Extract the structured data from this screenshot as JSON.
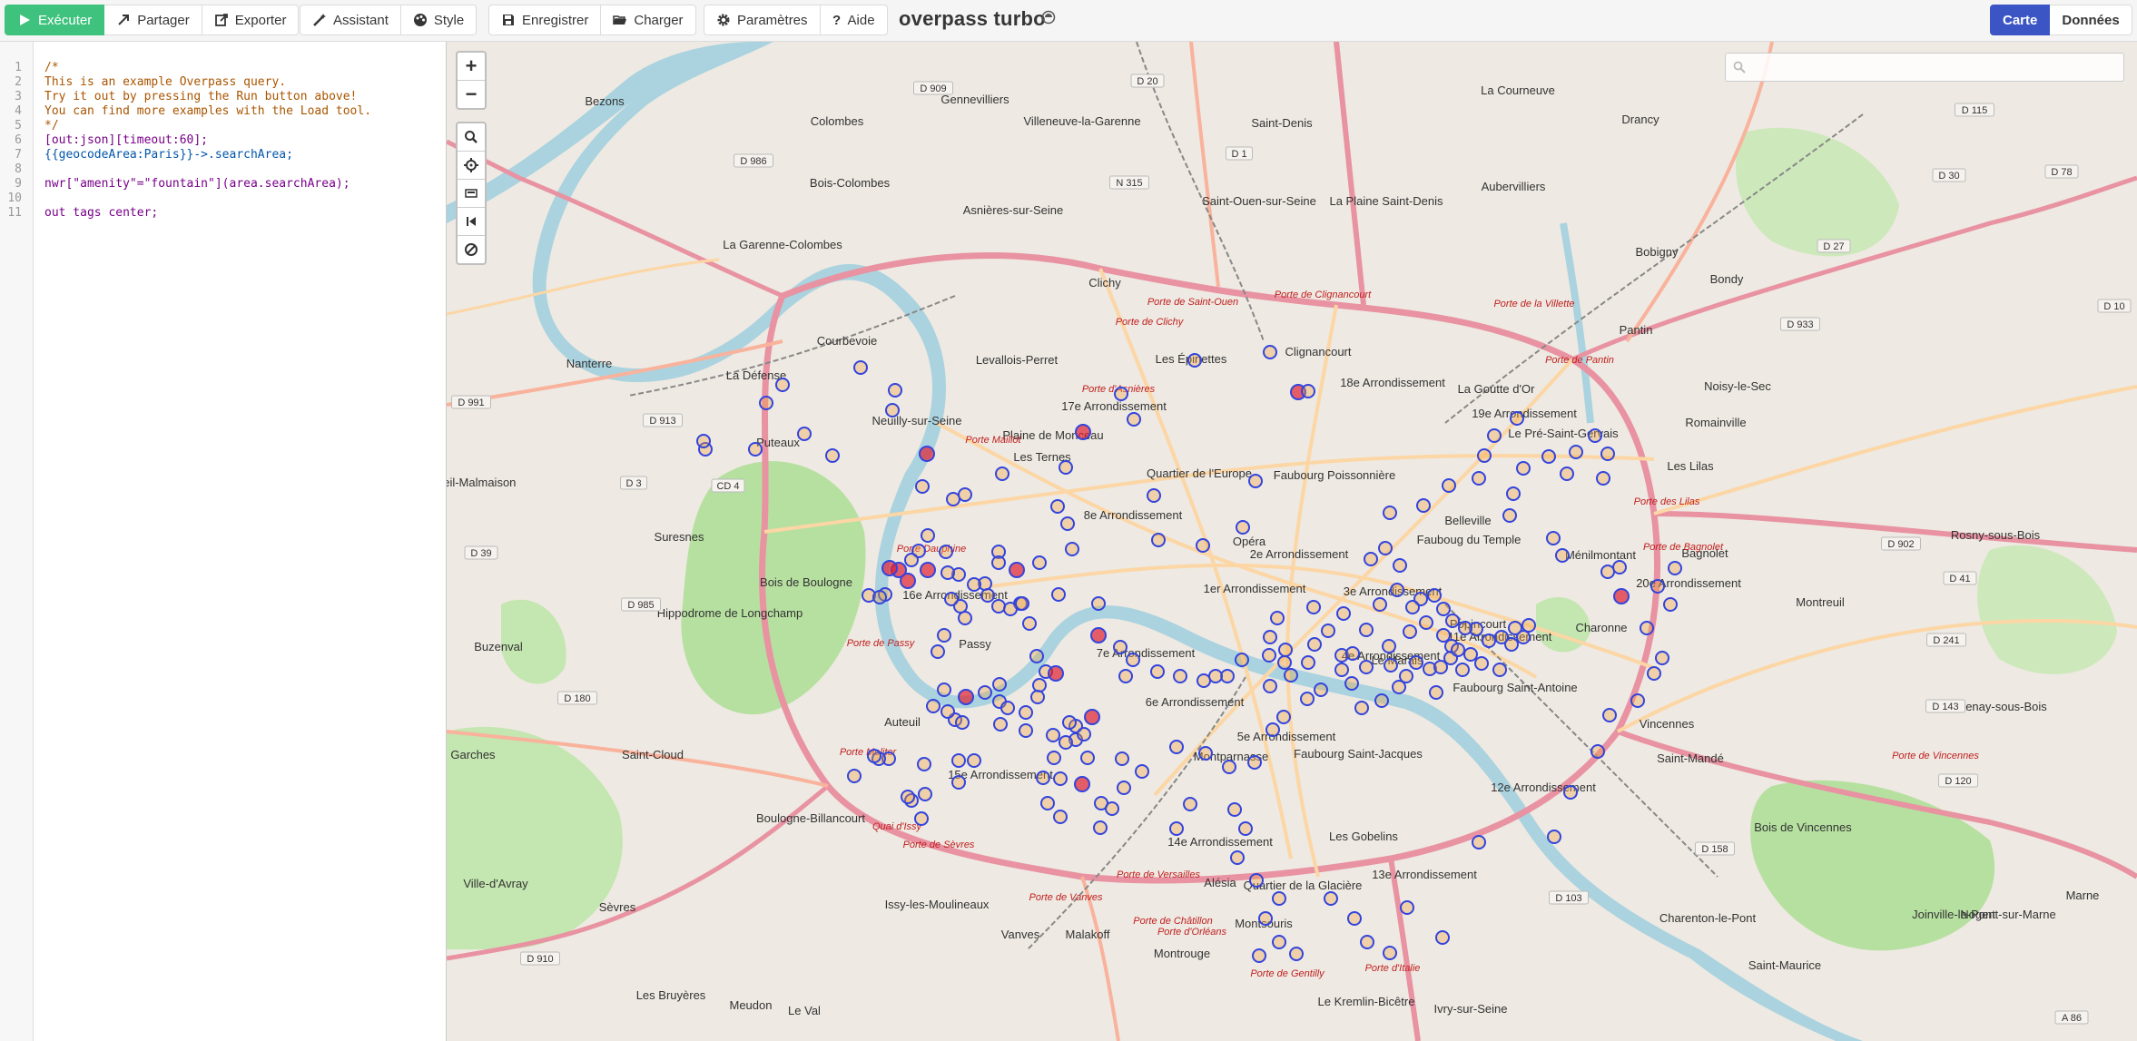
{
  "toolbar": {
    "run": {
      "label": "Exécuter",
      "icon": "play-icon"
    },
    "share": {
      "label": "Partager",
      "icon": "share-icon"
    },
    "export": {
      "label": "Exporter",
      "icon": "export-icon"
    },
    "wizard": {
      "label": "Assistant",
      "icon": "wand-icon"
    },
    "style": {
      "label": "Style",
      "icon": "palette-icon"
    },
    "save": {
      "label": "Enregistrer",
      "icon": "save-icon"
    },
    "load": {
      "label": "Charger",
      "icon": "folder-icon"
    },
    "settings": {
      "label": "Paramètres",
      "icon": "gear-icon"
    },
    "help": {
      "label": "Aide",
      "icon": "question-icon"
    },
    "map_tab": {
      "label": "Carte"
    },
    "data_tab": {
      "label": "Données"
    }
  },
  "app_title": "overpass turbo",
  "editor": {
    "line_numbers": [
      "1",
      "2",
      "3",
      "4",
      "5",
      "6",
      "7",
      "8",
      "9",
      "10",
      "11"
    ],
    "lines": [
      "/*",
      "This is an example Overpass query.",
      "Try it out by pressing the Run button above!",
      "You can find more examples with the Load tool.",
      "*/",
      "[out:json][timeout:60];",
      "{{geocodeArea:Paris}}->.searchArea;",
      "",
      "nwr[\"amenity\"=\"fountain\"](area.searchArea);",
      "",
      "out tags center;"
    ]
  },
  "map": {
    "zoom_in": "+",
    "zoom_out": "−",
    "tools": [
      "zoom-to-data-icon",
      "locate-icon",
      "toggle-layer-icon",
      "previous-view-icon",
      "clear-icon"
    ],
    "search_placeholder": "",
    "colors": {
      "marker_stroke": "#3344dd",
      "marker_fill": "#f2a33c",
      "highlight_fill": "#e02030",
      "water": "#aad3df",
      "park": "#c8eeb0",
      "motorway": "#e892a2",
      "trunk": "#f9b29c",
      "primary": "#fcd6a4"
    },
    "labels": [
      "Bezons",
      "Colombes",
      "Gennevilliers",
      "Villeneuve-la-Garenne",
      "Saint-Denis",
      "La Courneuve",
      "Drancy",
      "Bois-Colombes",
      "Asnières-sur-Seine",
      "Saint-Ouen-sur-Seine",
      "La Plaine Saint-Denis",
      "Aubervilliers",
      "Bobigny",
      "Bondy",
      "La Garenne-Colombes",
      "Clichy",
      "Pantin",
      "Nanterre",
      "Courbevoie",
      "Levallois-Perret",
      "Les Épinettes",
      "Clignancourt",
      "18e Arrondissement",
      "La Goutte d'Or",
      "19e Arrondissement",
      "Noisy-le-Sec",
      "Romainville",
      "La Défense",
      "Neuilly-sur-Seine",
      "17e Arrondissement",
      "Plaine de Monceau",
      "Le Pré-Saint-Gervais",
      "Les Lilas",
      "Puteaux",
      "Les Ternes",
      "Quartier de l'Europe",
      "Faubourg Poissonnière",
      "Belleville",
      "Bagnolet",
      "Montreuil",
      "Suresnes",
      "8e Arrondissement",
      "Opéra",
      "2e Arrondissement",
      "Fauboug du Temple",
      "Ménilmontant",
      "20e Arrondissement",
      "Rosny-sous-Bois",
      "Bois de Boulogne",
      "16e Arrondissement",
      "1er Arrondissement",
      "3e Arrondissement",
      "Popincourt",
      "11e Arrondissement",
      "Charonne",
      "Rueil-Malmaison",
      "Passy",
      "7e Arrondissement",
      "Le Marais",
      "4e Arrondissement",
      "Faubourg Saint-Antoine",
      "Fontenay-sous-Bois",
      "Buzenval",
      "Hippodrome de Longchamp",
      "6e Arrondissement",
      "5e Arrondissement",
      "Saint-Cloud",
      "Auteuil",
      "Montparnasse",
      "12e Arrondissement",
      "Vincennes",
      "Saint-Mandé",
      "Garches",
      "15e Arrondissement",
      "Faubourg Saint-Jacques",
      "Boulogne-Billancourt",
      "Les Gobelins",
      "Bois de Vincennes",
      "14e Arrondissement",
      "13e Arrondissement",
      "Ville-d'Avray",
      "Sèvres",
      "Issy-les-Moulineaux",
      "Alésia",
      "Quartier de la Glacière",
      "Charenton-le-Pont",
      "Joinville-le-Pont",
      "Vanves",
      "Malakoff",
      "Montrouge",
      "Montsouris",
      "Saint-Maurice",
      "Meudon",
      "Le Kremlin-Bicêtre",
      "Ivry-sur-Seine",
      "Les Bruyères",
      "Le Val",
      "Nogent-sur-Marne",
      "Marne"
    ],
    "road_refs": [
      "D 909",
      "D 20",
      "D 986",
      "D 1",
      "N 315",
      "D 115",
      "D 30",
      "D 78",
      "D 27",
      "D 933",
      "D 10",
      "D 991",
      "D 913",
      "D 3",
      "CD 4",
      "D 39",
      "D 985",
      "D 180",
      "D 902",
      "D 41",
      "D 241",
      "D 143",
      "D 120",
      "D 158",
      "D 103",
      "D 910",
      "A 86"
    ],
    "gates": [
      "Porte de Saint-Ouen",
      "Porte de Clignancourt",
      "Porte de la Villette",
      "Porte de Clichy",
      "Porte d'Asnières",
      "Porte de Pantin",
      "Porte Maillot",
      "Porte Dauphine",
      "Porte de Passy",
      "Porte Molitor",
      "Porte de Sèvres",
      "Porte de Versailles",
      "Porte de Vanves",
      "Porte de Châtillon",
      "Porte d'Orléans",
      "Porte de Gentilly",
      "Porte d'Italie",
      "Porte de Bagnolet",
      "Porte des Lilas",
      "Porte de Vincennes",
      "Quai d'Issy"
    ]
  }
}
